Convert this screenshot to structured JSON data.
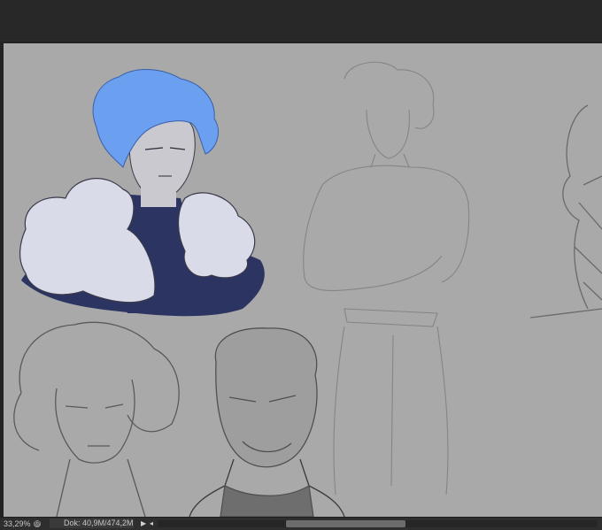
{
  "status": {
    "zoom": "33,29%",
    "zoom_icon": "zoom-icon",
    "doc_size": "Dok: 40,9M/474,2M",
    "arrow_icon": "play-arrow-icon",
    "scroll_left_icon": "scroll-left-icon"
  },
  "colors": {
    "canvas_bg": "#a9a9a9",
    "hair_blue": "#6b9ff0",
    "coat_navy": "#2c3462",
    "fur_white": "#d9dbe8",
    "skin": "#c9c9cf"
  }
}
